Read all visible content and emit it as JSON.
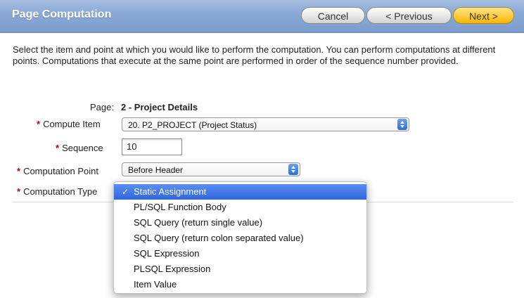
{
  "header": {
    "title": "Page Computation",
    "cancel_label": "Cancel",
    "previous_label": "< Previous",
    "next_label": "Next >"
  },
  "instructions": "Select the item and point at which you would like to perform the computation. You can perform computations at different points. Computations that execute at the same point are performed in order of the sequence number provided.",
  "form": {
    "page_label": "Page:",
    "page_value": "2 - Project Details",
    "required_marker": "*",
    "compute_item_label": "Compute Item",
    "compute_item_value": "20. P2_PROJECT (Project Status)",
    "sequence_label": "Sequence",
    "sequence_value": "10",
    "computation_point_label": "Computation Point",
    "computation_point_value": "Before Header",
    "computation_type_label": "Computation Type"
  },
  "dropdown": {
    "check": "✓",
    "options": [
      "Static Assignment",
      "PL/SQL Function Body",
      "SQL Query (return single value)",
      "SQL Query (return colon separated value)",
      "SQL Expression",
      "PLSQL Expression",
      "Item Value"
    ],
    "selected_index": 0
  },
  "colors": {
    "header_blue": "#8aa8d4",
    "next_button_yellow": "#ffcc3e",
    "required_red": "#c00000",
    "selection_blue": "#2f66dc"
  }
}
